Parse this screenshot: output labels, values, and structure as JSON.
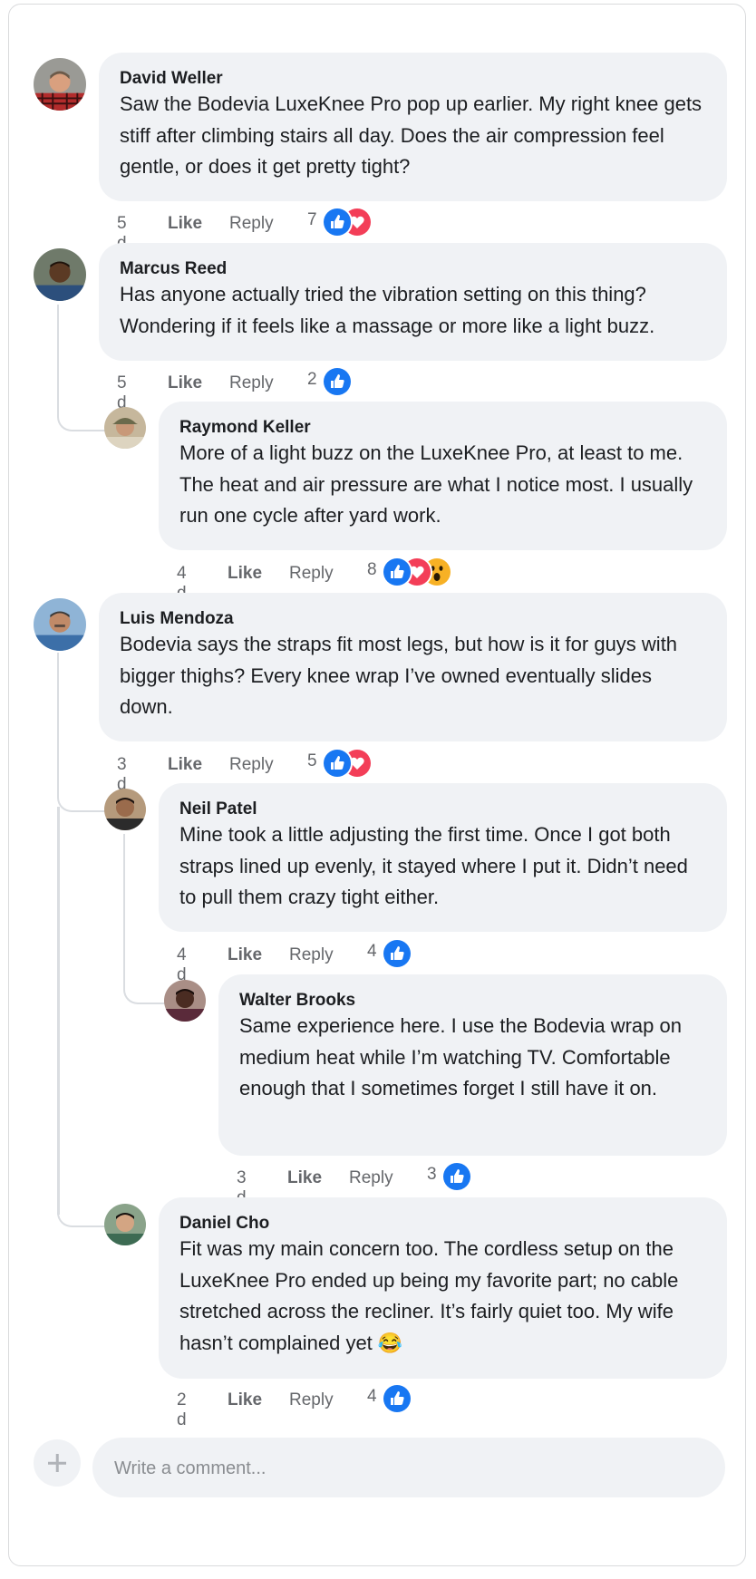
{
  "comments": [
    {
      "name": "David Weller",
      "text": "Saw the Bodevia LuxeKnee Pro pop up earlier. My right knee gets stiff after climbing stairs all day. Does the air compression feel gentle, or does it get pretty tight?",
      "time": "5 d",
      "like": "Like",
      "reply": "Reply",
      "count": "7",
      "reactions": [
        "like-reaction-icon",
        "love-reaction-icon"
      ]
    },
    {
      "name": "Marcus Reed",
      "text": "Has anyone actually tried the vibration setting on this thing? Wondering if it feels like a massage or more like a light buzz.",
      "time": "5 d",
      "like": "Like",
      "reply": "Reply",
      "count": "2",
      "reactions": [
        "like-reaction-icon"
      ]
    },
    {
      "name": "Raymond Keller",
      "text": "More of a light buzz on the LuxeKnee Pro, at least to me. The heat and air pressure are what I notice most. I usually run one cycle after yard work.",
      "time": "4 d",
      "like": "Like",
      "reply": "Reply",
      "count": "8",
      "reactions": [
        "like-reaction-icon",
        "love-reaction-icon",
        "wow-reaction-icon"
      ]
    },
    {
      "name": "Luis Mendoza",
      "text": "Bodevia says the straps fit most legs, but how is it for guys with bigger thighs? Every knee wrap I’ve owned eventually slides down.",
      "time": "3 d",
      "like": "Like",
      "reply": "Reply",
      "count": "5",
      "reactions": [
        "like-reaction-icon",
        "love-reaction-icon"
      ]
    },
    {
      "name": "Neil Patel",
      "text": "Mine took a little adjusting the first time. Once I got both straps lined up evenly, it stayed where I put it. Didn’t need to pull them crazy tight either.",
      "time": "4 d",
      "like": "Like",
      "reply": "Reply",
      "count": "4",
      "reactions": [
        "like-reaction-icon"
      ]
    },
    {
      "name": "Walter Brooks",
      "text": "Same experience here. I use the Bodevia wrap on medium heat while I’m watching TV. Comfortable enough that I sometimes forget I still have it on.",
      "time": "3 d",
      "like": "Like",
      "reply": "Reply",
      "count": "3",
      "reactions": [
        "like-reaction-icon"
      ]
    },
    {
      "name": "Daniel Cho",
      "text": "Fit was my main concern too. The cordless setup on the LuxeKnee Pro ended up being my favorite part; no cable stretched across the recliner. It’s fairly quiet too. My wife hasn’t complained yet 😂",
      "time": "2 d",
      "like": "Like",
      "reply": "Reply",
      "count": "4",
      "reactions": [
        "like-reaction-icon"
      ]
    }
  ],
  "composer": {
    "placeholder": "Write a comment..."
  },
  "colors": {
    "like_blue": "#1877f2",
    "love_red": "#f33e58",
    "wow_yellow": "#f7b125",
    "bubble_bg": "#f0f2f5"
  }
}
